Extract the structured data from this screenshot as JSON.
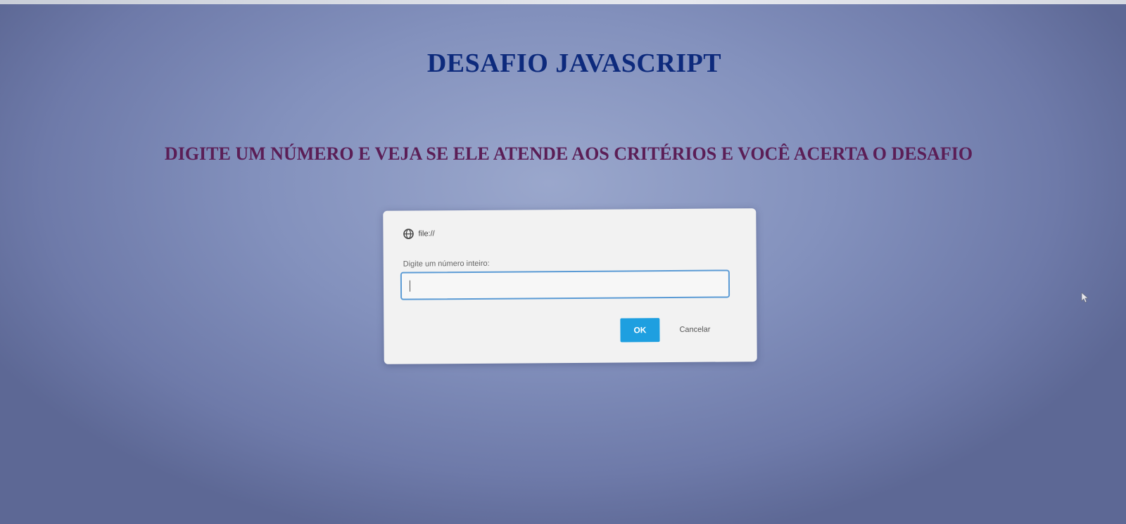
{
  "page": {
    "title": "DESAFIO JAVASCRIPT",
    "subtitle": "DIGITE UM NÚMERO E VEJA SE ELE ATENDE AOS CRITÉRIOS E VOCÊ ACERTA O DESAFIO"
  },
  "dialog": {
    "origin": "file://",
    "message": "Digite um número inteiro:",
    "input_value": "",
    "ok_label": "OK",
    "cancel_label": "Cancelar",
    "icon": "globe-icon"
  },
  "colors": {
    "title": "#0d2a7c",
    "subtitle": "#5b1e56",
    "ok_button": "#1e9fe0",
    "input_border": "#5b9bd5"
  }
}
